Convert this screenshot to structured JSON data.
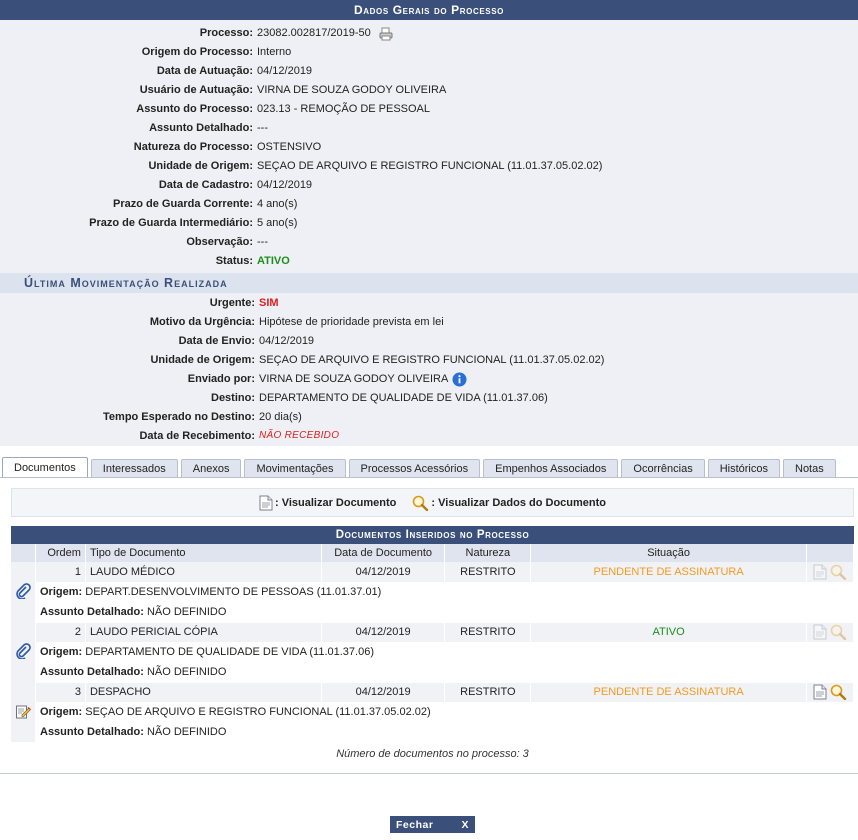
{
  "header": {
    "title": "Dados Gerais do Processo"
  },
  "general": [
    {
      "label": "Processo:",
      "value": "23082.002817/2019-50"
    },
    {
      "label": "Origem do Processo:",
      "value": "Interno"
    },
    {
      "label": "Data de Autuação:",
      "value": "04/12/2019"
    },
    {
      "label": "Usuário de Autuação:",
      "value": "VIRNA DE SOUZA GODOY OLIVEIRA"
    },
    {
      "label": "Assunto do Processo:",
      "value": "023.13 - REMOÇÃO DE PESSOAL"
    },
    {
      "label": "Assunto Detalhado:",
      "value": "---"
    },
    {
      "label": "Natureza do Processo:",
      "value": "OSTENSIVO"
    },
    {
      "label": "Unidade de Origem:",
      "value": "SEÇAO DE ARQUIVO E REGISTRO FUNCIONAL (11.01.37.05.02.02)"
    },
    {
      "label": "Data de Cadastro:",
      "value": "04/12/2019"
    },
    {
      "label": "Prazo de Guarda Corrente:",
      "value": "4 ano(s)"
    },
    {
      "label": "Prazo de Guarda Intermediário:",
      "value": "5 ano(s)"
    },
    {
      "label": "Observação:",
      "value": "---"
    },
    {
      "label": "Status:",
      "value": "ATIVO"
    }
  ],
  "last_move": {
    "title": "Última Movimentação Realizada",
    "rows": [
      {
        "label": "Urgente:",
        "value": "SIM"
      },
      {
        "label": "Motivo da Urgência:",
        "value": "Hipótese de prioridade prevista em lei"
      },
      {
        "label": "Data de Envio:",
        "value": "04/12/2019"
      },
      {
        "label": "Unidade de Origem:",
        "value": "SEÇAO DE ARQUIVO E REGISTRO FUNCIONAL (11.01.37.05.02.02)"
      },
      {
        "label": "Enviado por:",
        "value": "VIRNA DE SOUZA GODOY OLIVEIRA"
      },
      {
        "label": "Destino:",
        "value": "DEPARTAMENTO DE QUALIDADE DE VIDA (11.01.37.06)"
      },
      {
        "label": "Tempo Esperado no Destino:",
        "value": "20 dia(s)"
      },
      {
        "label": "Data de Recebimento:",
        "value": "NÃO RECEBIDO"
      }
    ]
  },
  "tabs": [
    "Documentos",
    "Interessados",
    "Anexos",
    "Movimentações",
    "Processos Acessórios",
    "Empenhos Associados",
    "Ocorrências",
    "Históricos",
    "Notas"
  ],
  "legend": {
    "view_doc": ": Visualizar Documento",
    "view_data": ": Visualizar Dados do Documento"
  },
  "docs": {
    "title": "Documentos Inseridos no Processo",
    "columns": [
      "Ordem",
      "Tipo de Documento",
      "Data de Documento",
      "Natureza",
      "Situação"
    ],
    "rows": [
      {
        "ordem": "1",
        "tipo": "LAUDO MÉDICO",
        "data": "04/12/2019",
        "natureza": "RESTRITO",
        "situacao": "PENDENTE DE ASSINATURA",
        "origem_label": "Origem:",
        "origem": "DEPART.DESENVOLVIMENTO DE PESSOAS (11.01.37.01)",
        "assunto_label": "Assunto Detalhado:",
        "assunto": "NÃO DEFINIDO"
      },
      {
        "ordem": "2",
        "tipo": "LAUDO PERICIAL CÓPIA",
        "data": "04/12/2019",
        "natureza": "RESTRITO",
        "situacao": "ATIVO",
        "origem_label": "Origem:",
        "origem": "DEPARTAMENTO DE QUALIDADE DE VIDA (11.01.37.06)",
        "assunto_label": "Assunto Detalhado:",
        "assunto": "NÃO DEFINIDO"
      },
      {
        "ordem": "3",
        "tipo": "DESPACHO",
        "data": "04/12/2019",
        "natureza": "RESTRITO",
        "situacao": "PENDENTE DE ASSINATURA",
        "origem_label": "Origem:",
        "origem": "SEÇAO DE ARQUIVO E REGISTRO FUNCIONAL (11.01.37.05.02.02)",
        "assunto_label": "Assunto Detalhado:",
        "assunto": "NÃO DEFINIDO"
      }
    ],
    "count": "Número de documentos no processo: 3"
  },
  "footer": {
    "close_label": "Fechar",
    "close_x": "X"
  },
  "colors": {
    "header_bg": "#3a4f79",
    "status_active": "#1a8f1a",
    "urgent": "#e01c1c",
    "pending": "#f39b1e"
  }
}
